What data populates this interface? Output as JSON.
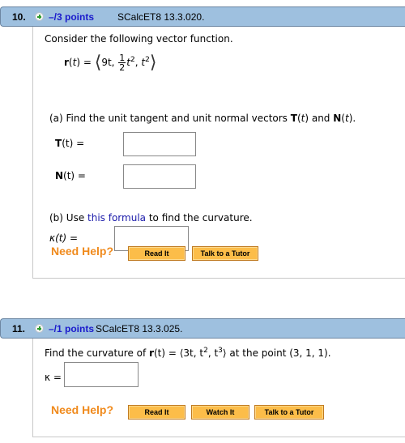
{
  "questions": [
    {
      "number": "10.",
      "points": "–/3 points",
      "source": "SCalcET8 13.3.020.",
      "prompt": "Consider the following vector function.",
      "function": {
        "lhs": "r",
        "var": "t",
        "eq": "=",
        "comp1": "9t,",
        "frac_num": "1",
        "frac_den": "2",
        "comp2": "t",
        "comp2_exp": "2",
        "sep": ",",
        "comp3": "t",
        "comp3_exp": "2"
      },
      "part_a": {
        "text_before": "(a) Find the unit tangent and unit normal vectors ",
        "T": "T",
        "and": " and ",
        "N": "N",
        "end": "."
      },
      "fields": [
        {
          "label_bold": "T",
          "label_rest": "(t) =",
          "value": ""
        },
        {
          "label_bold": "N",
          "label_rest": "(t) =",
          "value": ""
        }
      ],
      "part_b": {
        "before": "(b) Use ",
        "link": "this formula",
        "after": " to find the curvature."
      },
      "kappa_label": "κ(t) =",
      "kappa_value": "",
      "help_label": "Need Help?",
      "buttons": [
        "Read It",
        "Talk to a Tutor"
      ]
    },
    {
      "number": "11.",
      "points": "–/1 points",
      "source": "SCalcET8 13.3.025.",
      "prompt_before": "Find the curvature of ",
      "r_label": "r",
      "r_rest": "(t) = ⟨3t, t",
      "exp1": "2",
      "mid": ", t",
      "exp2": "3",
      "close": "⟩",
      "prompt_after": " at the point  (3, 1, 1).",
      "kappa_label": "κ =",
      "kappa_value": "",
      "help_label": "Need Help?",
      "buttons": [
        "Read It",
        "Watch It",
        "Talk to a Tutor"
      ]
    }
  ]
}
